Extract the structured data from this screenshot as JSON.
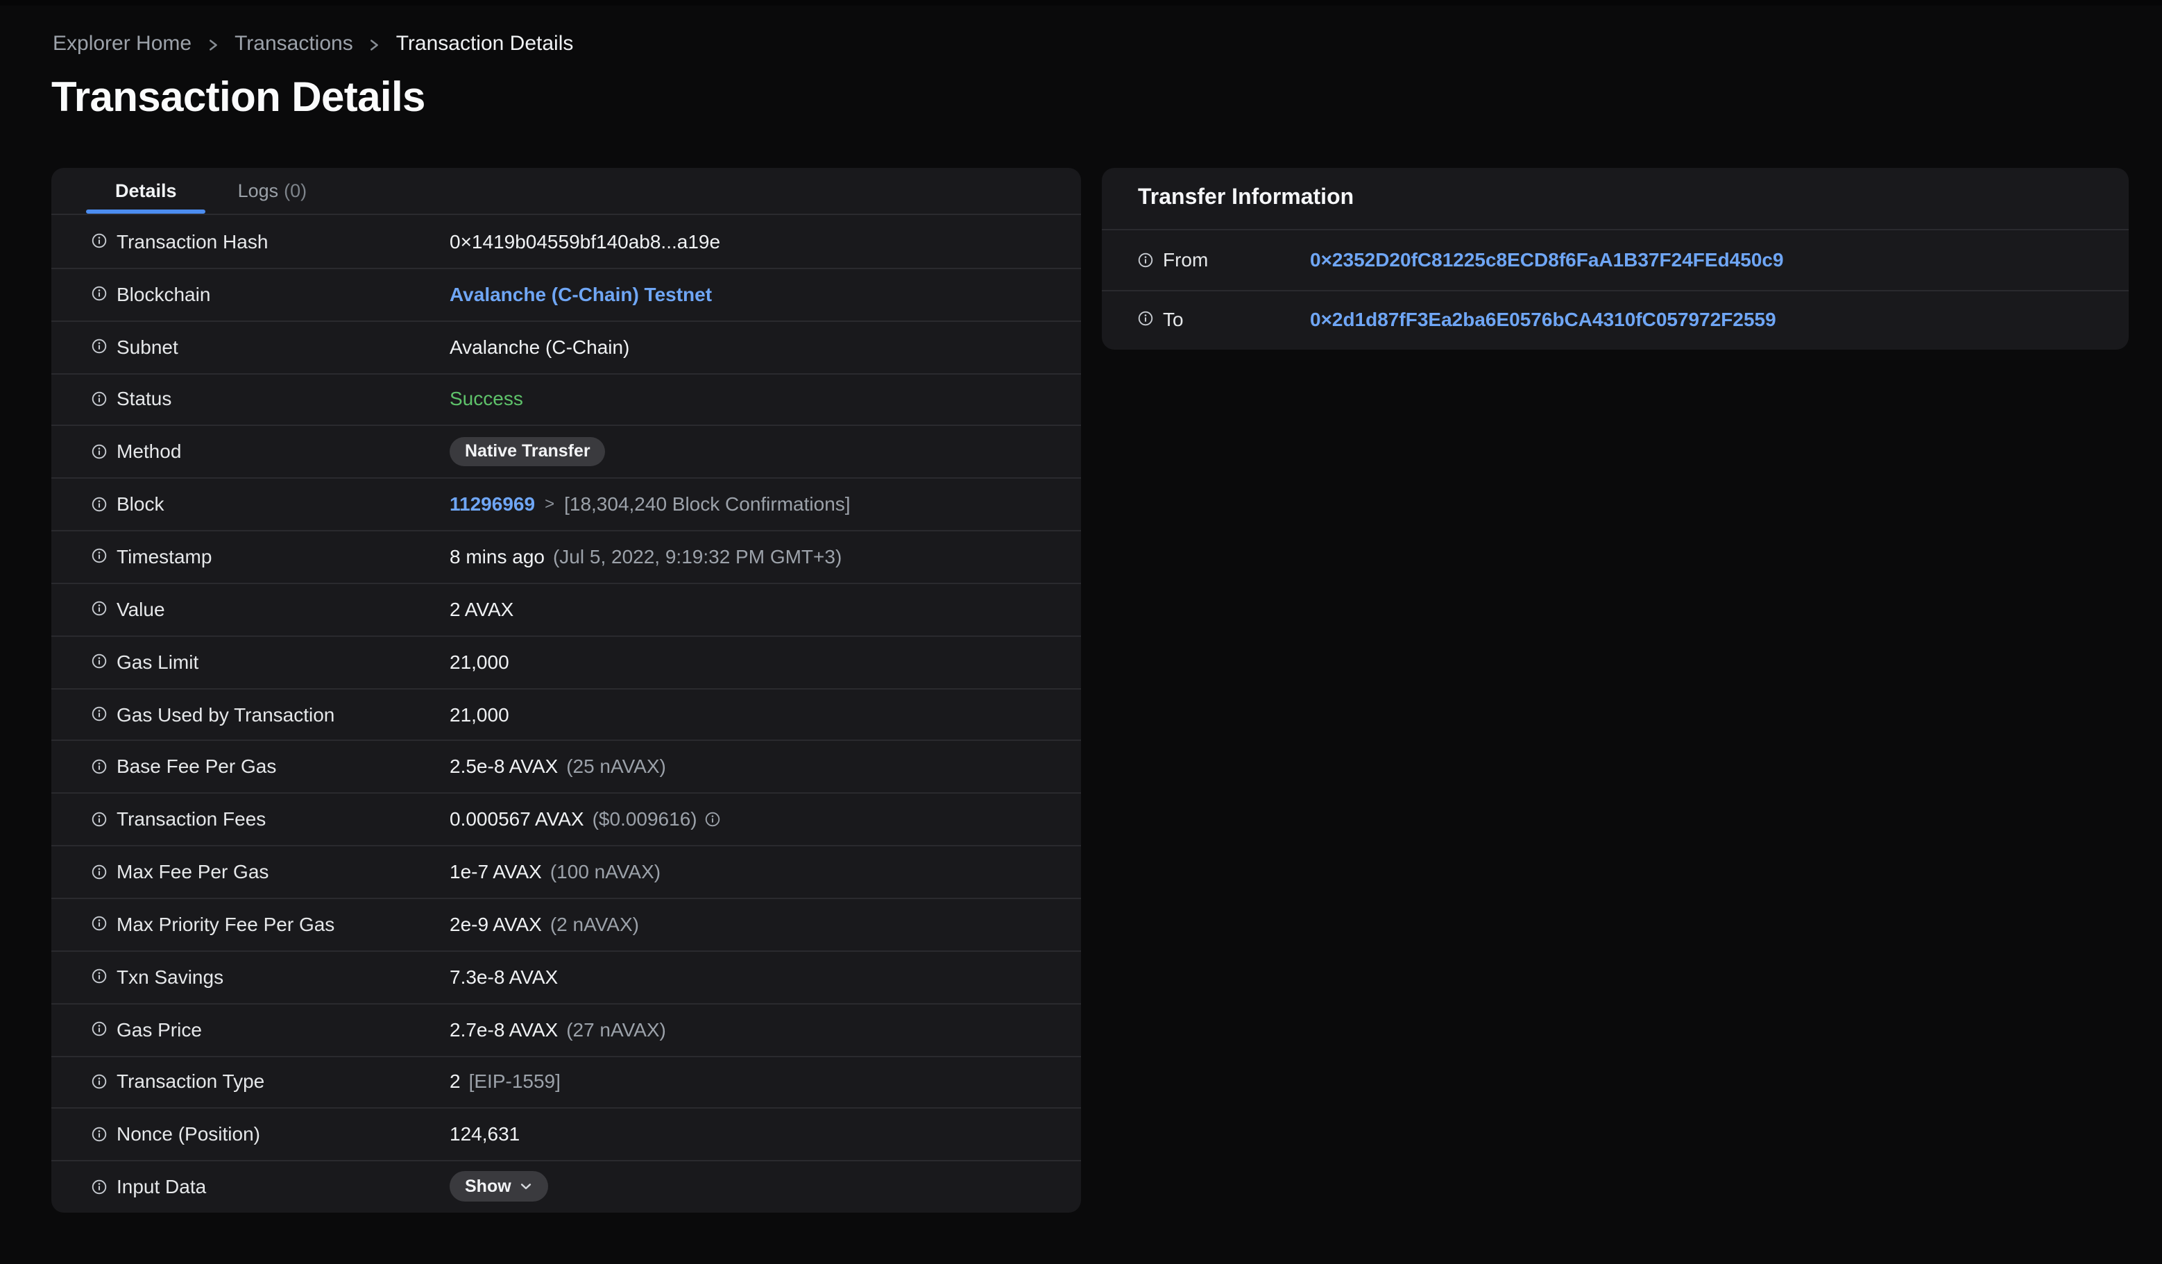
{
  "colors": {
    "page_bg": "#0A0A0B",
    "card_bg": "#19191C",
    "accent_blue": "#6FA6F5",
    "tab_underline": "#4C8DF0",
    "success_green": "#5EC26A",
    "badge_bg": "#3A3A3E",
    "text_primary": "#F0F2F4",
    "text_secondary": "#9CA2AA"
  },
  "icons": {
    "breadcrumb_separator": "chevron-right-icon",
    "row_label_prefix": "info-icon",
    "fee_tooltip": "info-icon",
    "show_button_suffix": "chevron-down-icon"
  },
  "breadcrumb": {
    "items": [
      {
        "label": "Explorer Home",
        "link": true
      },
      {
        "label": "Transactions",
        "link": true
      },
      {
        "label": "Transaction Details",
        "link": false
      }
    ]
  },
  "page_title": "Transaction Details",
  "tabs": [
    {
      "label": "Details",
      "active": true
    },
    {
      "label": "Logs",
      "count": "(0)",
      "active": false
    }
  ],
  "details": {
    "rows": [
      {
        "label": "Transaction Hash",
        "segments": [
          {
            "text": "0×1419b04559bf140ab8...a19e",
            "style": "primary"
          }
        ]
      },
      {
        "label": "Blockchain",
        "segments": [
          {
            "text": "Avalanche (C-Chain) Testnet",
            "style": "link",
            "name": "blockchain-link"
          }
        ]
      },
      {
        "label": "Subnet",
        "segments": [
          {
            "text": "Avalanche (C-Chain)",
            "style": "primary"
          }
        ]
      },
      {
        "label": "Status",
        "segments": [
          {
            "text": "Success",
            "style": "success",
            "name": "status-success"
          }
        ]
      },
      {
        "label": "Method",
        "segments": [
          {
            "text": "Native Transfer",
            "style": "badge",
            "name": "method-badge"
          }
        ]
      },
      {
        "label": "Block",
        "segments": [
          {
            "text": "11296969",
            "style": "link",
            "name": "block-link"
          },
          {
            "text": ">",
            "style": "sep"
          },
          {
            "text": "[18,304,240 Block Confirmations]",
            "style": "muted"
          }
        ]
      },
      {
        "label": "Timestamp",
        "segments": [
          {
            "text": "8 mins ago",
            "style": "primary"
          },
          {
            "text": "(Jul 5, 2022, 9:19:32 PM GMT+3)",
            "style": "muted"
          }
        ]
      },
      {
        "label": "Value",
        "segments": [
          {
            "text": "2 AVAX",
            "style": "primary"
          }
        ]
      },
      {
        "label": "Gas Limit",
        "segments": [
          {
            "text": "21,000",
            "style": "primary"
          }
        ]
      },
      {
        "label": "Gas Used by Transaction",
        "segments": [
          {
            "text": "21,000",
            "style": "primary"
          }
        ]
      },
      {
        "label": "Base Fee Per Gas",
        "segments": [
          {
            "text": "2.5e-8 AVAX",
            "style": "primary"
          },
          {
            "text": "(25 nAVAX)",
            "style": "muted"
          }
        ]
      },
      {
        "label": "Transaction Fees",
        "segments": [
          {
            "text": "0.000567 AVAX",
            "style": "primary"
          },
          {
            "text": "($0.009616)",
            "style": "muted"
          },
          {
            "icon": "info",
            "style": "icon",
            "name": "fee-info-icon"
          }
        ]
      },
      {
        "label": "Max Fee Per Gas",
        "segments": [
          {
            "text": "1e-7 AVAX",
            "style": "primary"
          },
          {
            "text": "(100 nAVAX)",
            "style": "muted"
          }
        ]
      },
      {
        "label": "Max Priority Fee Per Gas",
        "segments": [
          {
            "text": "2e-9 AVAX",
            "style": "primary"
          },
          {
            "text": "(2 nAVAX)",
            "style": "muted"
          }
        ]
      },
      {
        "label": "Txn Savings",
        "segments": [
          {
            "text": "7.3e-8 AVAX",
            "style": "primary"
          }
        ]
      },
      {
        "label": "Gas Price",
        "segments": [
          {
            "text": "2.7e-8 AVAX",
            "style": "primary"
          },
          {
            "text": "(27 nAVAX)",
            "style": "muted"
          }
        ]
      },
      {
        "label": "Transaction Type",
        "segments": [
          {
            "text": "2",
            "style": "primary"
          },
          {
            "text": "[EIP-1559]",
            "style": "muted"
          }
        ]
      },
      {
        "label": "Nonce (Position)",
        "segments": [
          {
            "text": "124,631",
            "style": "primary"
          }
        ]
      },
      {
        "label": "Input Data",
        "segments": [
          {
            "text": "Show",
            "style": "button",
            "name": "show-input-data-button"
          }
        ]
      }
    ]
  },
  "transfer": {
    "title": "Transfer Information",
    "rows": [
      {
        "label": "From",
        "address": "0×2352D20fC81225c8ECD8f6FaA1B37F24FEd450c9"
      },
      {
        "label": "To",
        "address": "0×2d1d87fF3Ea2ba6E0576bCA4310fC057972F2559"
      }
    ]
  }
}
